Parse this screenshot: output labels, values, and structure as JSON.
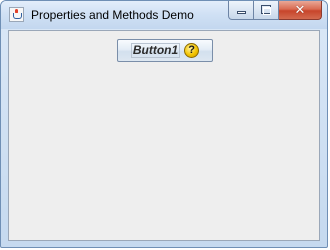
{
  "window": {
    "title": "Properties and Methods Demo",
    "close_glyph": "✕"
  },
  "content": {
    "button_label": "Button1",
    "help_glyph": "?"
  },
  "colors": {
    "titlebar": "#cfe0f4",
    "client_bg": "#eeeeee",
    "close_button": "#c7452b"
  },
  "icons": [
    "java-app-icon",
    "minimize-icon",
    "maximize-icon",
    "close-icon",
    "help-icon"
  ]
}
